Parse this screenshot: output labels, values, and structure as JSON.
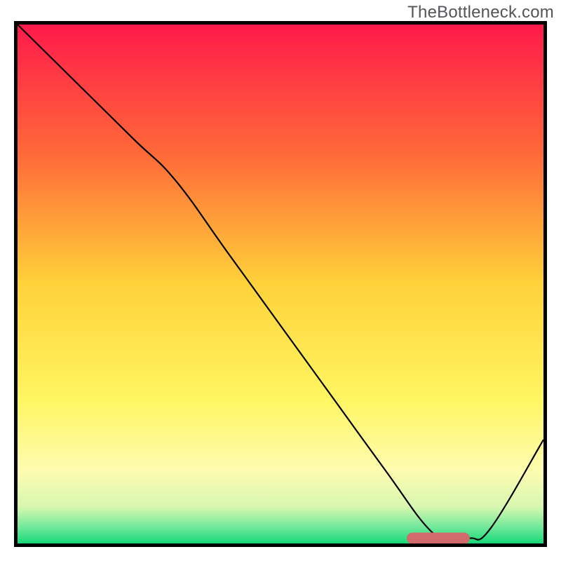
{
  "watermark": "TheBottleneck.com",
  "chart_data": {
    "type": "line",
    "title": "",
    "xlabel": "",
    "ylabel": "",
    "xlim": [
      0,
      100
    ],
    "ylim": [
      0,
      100
    ],
    "grid": false,
    "legend": false,
    "background_gradient": {
      "stops": [
        {
          "offset": 0.0,
          "color": "#ff1a4b"
        },
        {
          "offset": 0.25,
          "color": "#ff6a38"
        },
        {
          "offset": 0.5,
          "color": "#ffd23a"
        },
        {
          "offset": 0.72,
          "color": "#fff661"
        },
        {
          "offset": 0.86,
          "color": "#fdfcb0"
        },
        {
          "offset": 0.93,
          "color": "#d7f7b0"
        },
        {
          "offset": 0.97,
          "color": "#6de89a"
        },
        {
          "offset": 1.0,
          "color": "#15d878"
        }
      ]
    },
    "series": [
      {
        "name": "curve",
        "stroke": "#000000",
        "stroke_width": 2.2,
        "x": [
          0,
          10,
          22,
          30,
          40,
          50,
          60,
          70,
          78,
          82,
          86,
          90,
          100
        ],
        "y": [
          100,
          90,
          78,
          70,
          56,
          42,
          28,
          14,
          3,
          1,
          1,
          3,
          20
        ]
      }
    ],
    "markers": [
      {
        "name": "valley-marker",
        "shape": "rounded-rect",
        "fill": "#d16a6a",
        "x": 80,
        "y": 1,
        "width_pct": 12,
        "height_pct": 2.2
      }
    ]
  }
}
